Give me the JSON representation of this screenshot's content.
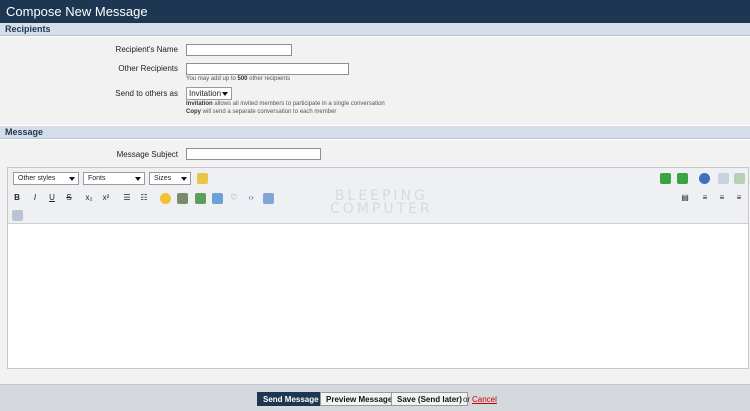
{
  "page": {
    "title": "Compose New Message"
  },
  "recipients": {
    "header": "Recipients",
    "name_label": "Recipient's Name",
    "name_value": "",
    "others_label": "Other Recipients",
    "others_value": "",
    "others_hint_pre": "You may add up to ",
    "others_hint_count": "500",
    "others_hint_post": " other recipients",
    "send_label": "Send to others as",
    "send_value": "Invitation",
    "hint_invitation_bold": "Invitation",
    "hint_invitation_rest": " allows all invited members to participate in a single conversation",
    "hint_copy_bold": "Copy",
    "hint_copy_rest": " will send a separate conversation to each member"
  },
  "message": {
    "header": "Message",
    "subject_label": "Message Subject",
    "subject_value": "",
    "body": ""
  },
  "editor": {
    "styles": "Other styles",
    "fonts": "Fonts",
    "sizes": "Sizes",
    "bold": "B",
    "italic": "I",
    "underline": "U",
    "strike": "S",
    "sub": "x₂",
    "sup": "x²",
    "watermark_line1": "BLEEPING",
    "watermark_line2": "COMPUTER"
  },
  "footer": {
    "send": "Send Message",
    "preview": "Preview Message",
    "save": "Save (Send later)",
    "or": "or",
    "cancel": "Cancel"
  },
  "colors": {
    "brand": "#1d3652",
    "section": "#d5dde8",
    "cancel": "#cc0000"
  }
}
